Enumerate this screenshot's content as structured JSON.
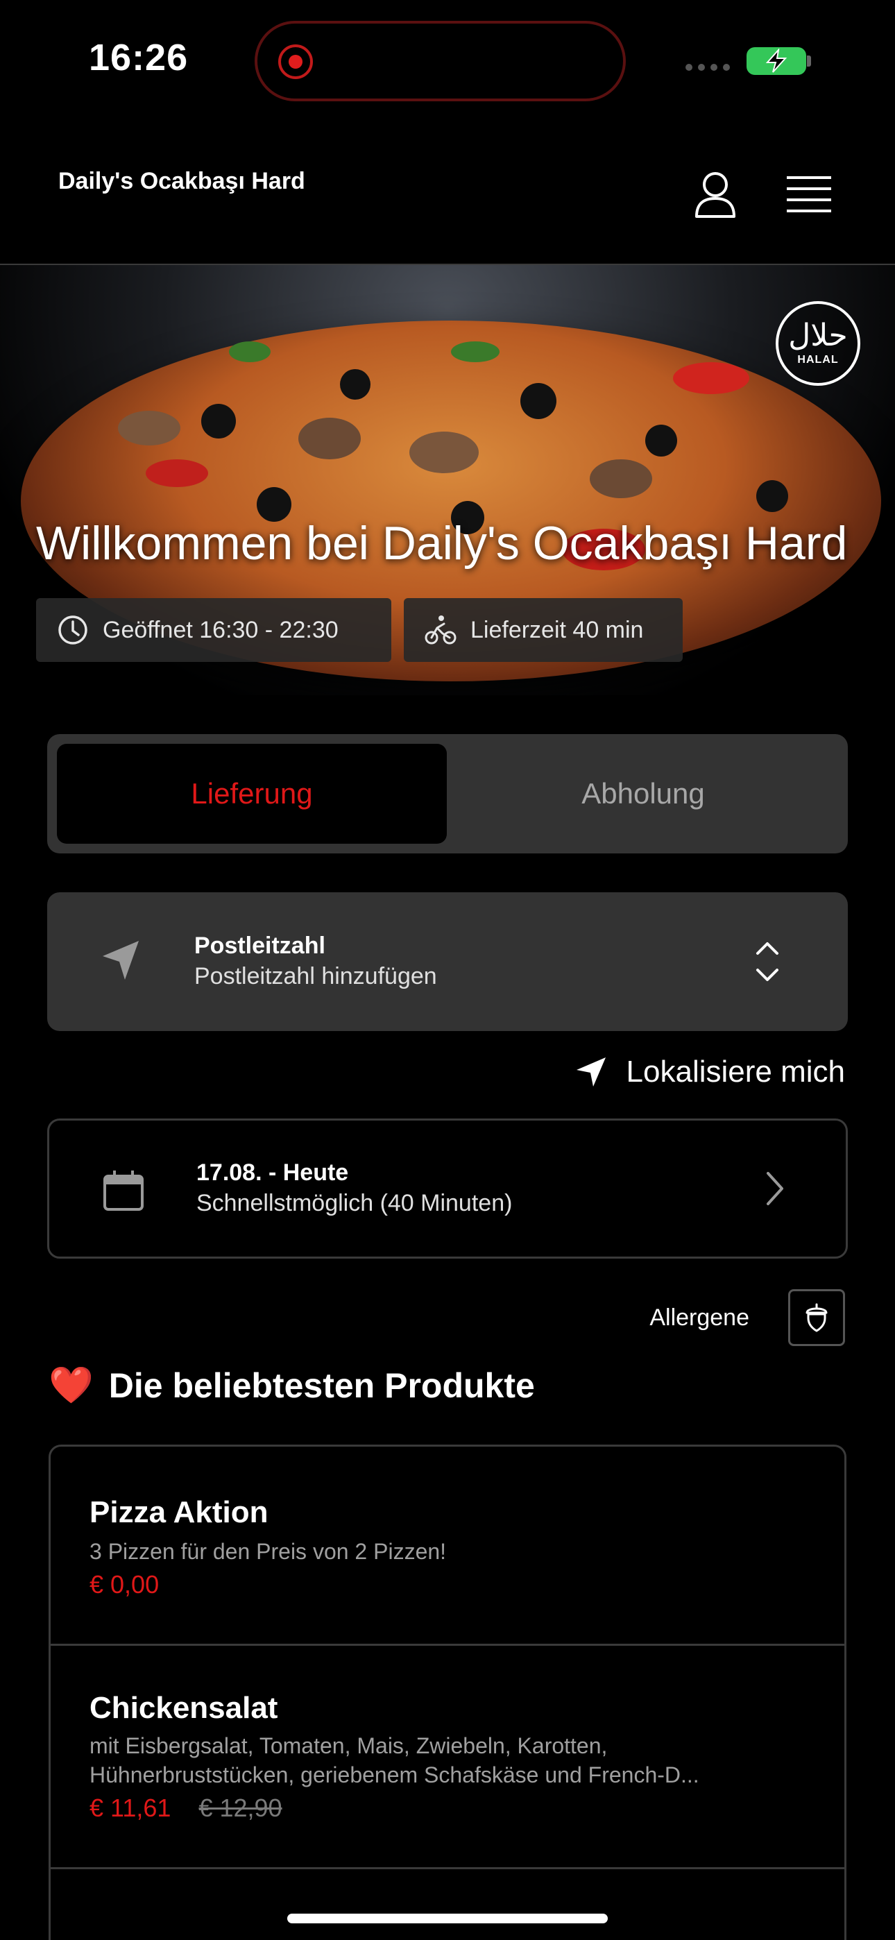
{
  "status_bar": {
    "time": "16:26"
  },
  "header": {
    "title": "Daily's Ocakbaşı Hard",
    "user_icon": "user-icon",
    "menu_icon": "menu-icon"
  },
  "hero": {
    "title": "Willkommen bei Daily's Ocakbaşı Hard",
    "halal_arabic": "حلال",
    "halal_label": "HALAL",
    "opening_hours": "Geöffnet 16:30 - 22:30",
    "delivery_time": "Lieferzeit 40 min"
  },
  "order_mode": {
    "active": "Lieferung",
    "inactive": "Abholung",
    "active_color": "#e01818"
  },
  "postal_code": {
    "label": "Postleitzahl",
    "placeholder": "Postleitzahl hinzufügen"
  },
  "locate": {
    "label": "Lokalisiere mich"
  },
  "date": {
    "label": "17.08. - Heute",
    "value": "Schnellstmöglich (40 Minuten)"
  },
  "allergens": {
    "label": "Allergene"
  },
  "popular": {
    "title": "Die beliebtesten Produkte",
    "emoji": "❤️",
    "products": [
      {
        "name": "Pizza Aktion",
        "description": "3 Pizzen für den Preis von 2 Pizzen!",
        "price": "€ 0,00"
      },
      {
        "name": "Chickensalat",
        "description_line1": "mit Eisbergsalat, Tomaten, Mais, Zwiebeln, Karotten,",
        "description_line2": "Hühnerbruststücken, geriebenem Schafskäse und French-D...",
        "price": "€ 11,61",
        "old_price": "€ 12,90"
      }
    ]
  },
  "colors": {
    "accent": "#e01818",
    "background": "#000000",
    "card": "#333333"
  }
}
